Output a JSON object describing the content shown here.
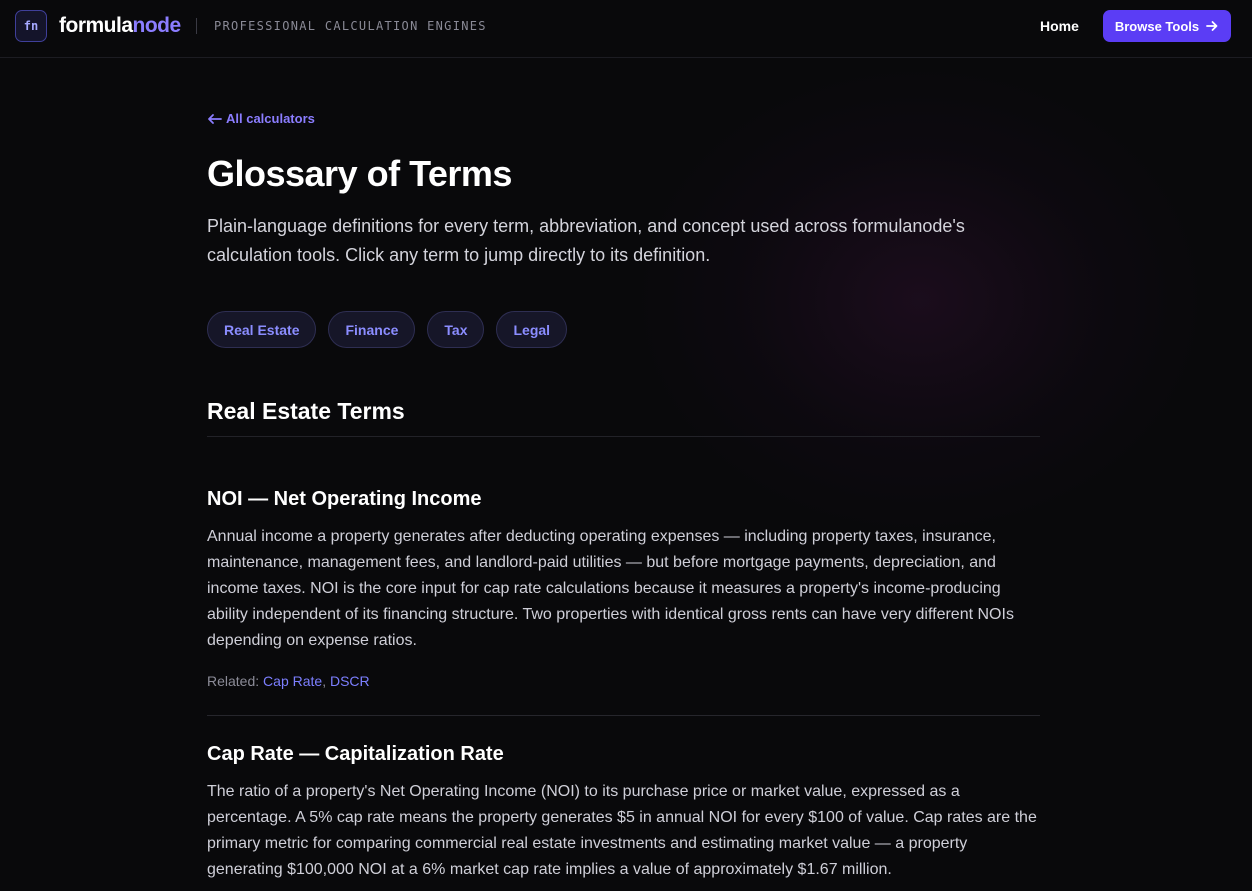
{
  "header": {
    "logo_badge": "fn",
    "brand_part1": "formula",
    "brand_part2": "node",
    "tagline": "PROFESSIONAL CALCULATION ENGINES",
    "nav_home": "Home",
    "browse_label": "Browse Tools"
  },
  "main": {
    "back_link": "All calculators",
    "title": "Glossary of Terms",
    "intro": "Plain-language definitions for every term, abbreviation, and concept used across formulanode's calculation tools. Click any term to jump directly to its definition.",
    "categories": [
      "Real Estate",
      "Finance",
      "Tax",
      "Legal"
    ],
    "section_title": "Real Estate Terms",
    "terms": [
      {
        "title": "NOI — Net Operating Income",
        "definition": "Annual income a property generates after deducting operating expenses — including property taxes, insurance, maintenance, management fees, and landlord-paid utilities — but before mortgage payments, depreciation, and income taxes. NOI is the core input for cap rate calculations because it measures a property's income-producing ability independent of its financing structure. Two properties with identical gross rents can have very different NOIs depending on expense ratios.",
        "related_label": "Related:",
        "related": [
          "Cap Rate",
          "DSCR"
        ],
        "related_sep": ", "
      },
      {
        "title": "Cap Rate — Capitalization Rate",
        "definition": "The ratio of a property's Net Operating Income (NOI) to its purchase price or market value, expressed as a percentage. A 5% cap rate means the property generates $5 in annual NOI for every $100 of value. Cap rates are the primary metric for comparing commercial real estate investments and estimating market value — a property generating $100,000 NOI at a 6% market cap rate implies a value of approximately $1.67 million."
      }
    ]
  },
  "colors": {
    "background": "#09090b",
    "accent": "#5b3df5",
    "link": "#8b7dff"
  }
}
